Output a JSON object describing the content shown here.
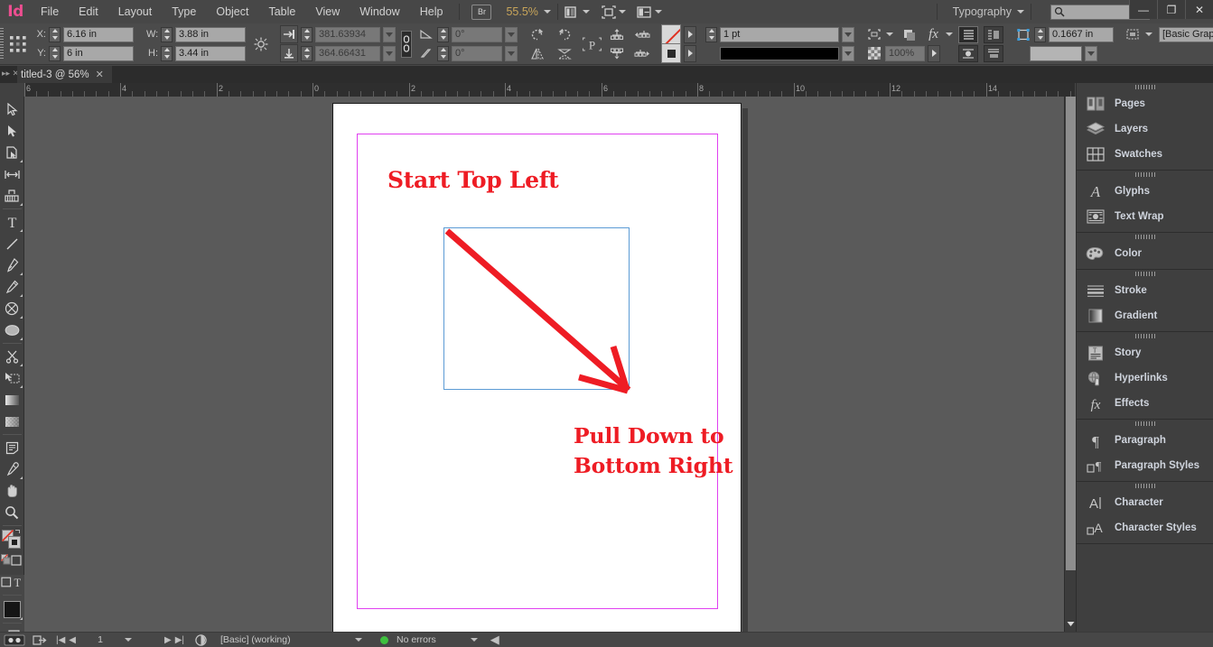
{
  "app": {
    "logo": "Id",
    "window_buttons": {
      "minimize": "—",
      "restore": "❐",
      "close": "✕"
    }
  },
  "menubar": {
    "items": [
      "File",
      "Edit",
      "Layout",
      "Type",
      "Object",
      "Table",
      "View",
      "Window",
      "Help"
    ],
    "bridge_label": "Br",
    "zoom_level": "55.5%",
    "view_mode_icon": "screen-mode-icon",
    "preview_icon": "preview-mode-icon",
    "layout_icon": "arrange-documents-icon",
    "workspace": "Typography",
    "search_placeholder": "",
    "search_icon": "search-icon"
  },
  "controlbar": {
    "reference_point_icon": "reference-point-proxy-icon",
    "x_label": "X:",
    "x_value": "6.16 in",
    "y_label": "Y:",
    "y_value": "6 in",
    "w_label": "W:",
    "w_value": "3.88 in",
    "h_label": "H:",
    "h_value": "3.44 in",
    "constrain_icon": "constrain-proportions-icon",
    "scale_x_icon": "scale-x-icon",
    "scale_x_value": "381.63934",
    "scale_y_icon": "scale-y-icon",
    "scale_y_value": "364.66431",
    "chain_icon": "link-chain-icon",
    "rotate_icon": "rotation-angle-icon",
    "rotate_value": "0°",
    "shear_icon": "shear-angle-icon",
    "shear_value": "0°",
    "rotate_ccw_icon": "rotate-counterclockwise-icon",
    "rotate_cw_icon": "rotate-clockwise-icon",
    "flip_h_icon": "flip-horizontal-icon",
    "flip_v_icon": "flip-vertical-icon",
    "container_icon": "select-container-icon",
    "align_up_icon": "bring-forward-icon",
    "align_prev_icon": "select-previous-icon",
    "align_down_icon": "send-backward-icon",
    "align_next_icon": "select-next-icon",
    "fill_swatch": "none-fill-swatch",
    "stroke_swatch": "black-stroke-swatch",
    "stroke_weight": "1 pt",
    "stroke_style_label": "solid-stroke-style",
    "effects_label": "fx",
    "opacity_value": "100%",
    "text_wrap_icon": "text-wrap-icon",
    "corner_value": "0.1667 in",
    "object_style": "[Basic Graphics Frame]",
    "bolt_icon": "quick-apply-icon"
  },
  "doctab": {
    "title": "titled-3 @ 56%",
    "close_icon": "close-tab-icon"
  },
  "ruler": {
    "units": "in",
    "labels": [
      "6",
      "4",
      "2",
      "0",
      "2",
      "4",
      "6",
      "8",
      "10",
      "12",
      "14"
    ]
  },
  "toolbox": {
    "tools": [
      {
        "name": "selection-tool",
        "glyph": "selection"
      },
      {
        "name": "direct-selection-tool",
        "glyph": "direct-selection"
      },
      {
        "name": "page-tool",
        "glyph": "page"
      },
      {
        "name": "gap-tool",
        "glyph": "gap"
      },
      {
        "name": "content-collector-tool",
        "glyph": "collector"
      },
      {
        "name": "type-tool",
        "glyph": "type"
      },
      {
        "name": "line-tool",
        "glyph": "line"
      },
      {
        "name": "pen-tool",
        "glyph": "pen"
      },
      {
        "name": "pencil-tool",
        "glyph": "pencil"
      },
      {
        "name": "frame-tool",
        "glyph": "frame-ellipse"
      },
      {
        "name": "ellipse-tool",
        "glyph": "ellipse"
      },
      {
        "name": "scissors-tool",
        "glyph": "scissors"
      },
      {
        "name": "free-transform-tool",
        "glyph": "transform"
      },
      {
        "name": "gradient-swatch-tool",
        "glyph": "gradient"
      },
      {
        "name": "gradient-feather-tool",
        "glyph": "feather"
      },
      {
        "name": "note-tool",
        "glyph": "note"
      },
      {
        "name": "eyedropper-tool",
        "glyph": "eyedropper"
      },
      {
        "name": "hand-tool",
        "glyph": "hand"
      },
      {
        "name": "zoom-tool",
        "glyph": "zoom"
      }
    ]
  },
  "document": {
    "page_label": "page-1",
    "texts": [
      {
        "name": "headline-start",
        "content": "Start Top Left"
      },
      {
        "name": "headline-pull-line1",
        "content": "Pull Down to"
      },
      {
        "name": "headline-pull-line2",
        "content": "Bottom Right"
      }
    ],
    "graphic": {
      "name": "arrow-graphic-frame",
      "description": "diagonal-arrow-pointing-down-right"
    },
    "colors": {
      "text_red": "#ee1c24",
      "margin_magenta": "#e040f0",
      "frame_blue": "#5b9bd5",
      "page_white": "#ffffff",
      "pasteboard": "#5a5a5a"
    }
  },
  "statusbar": {
    "page_number": "1",
    "preflight_profile": "[Basic] (working)",
    "error_status": "No errors",
    "status_dot_color": "#3fc03f",
    "go_to_first_icon": "first-page-icon",
    "go_to_prev_icon": "previous-page-icon",
    "go_to_next_icon": "next-page-icon",
    "go_to_last_icon": "last-page-icon",
    "preflight_icon": "preflight-icon",
    "bridge_icon": "reveal-in-bridge-icon",
    "export_icon": "export-icon"
  },
  "dock": {
    "groups": [
      {
        "name": "pages-group",
        "items": [
          {
            "label": "Pages",
            "icon": "pages-icon"
          },
          {
            "label": "Layers",
            "icon": "layers-icon"
          },
          {
            "label": "Swatches",
            "icon": "swatches-icon"
          }
        ]
      },
      {
        "name": "type-group",
        "items": [
          {
            "label": "Glyphs",
            "icon": "glyphs-icon"
          },
          {
            "label": "Text Wrap",
            "icon": "text-wrap-icon"
          }
        ]
      },
      {
        "name": "color-group",
        "items": [
          {
            "label": "Color",
            "icon": "color-palette-icon"
          }
        ]
      },
      {
        "name": "stroke-group",
        "items": [
          {
            "label": "Stroke",
            "icon": "stroke-icon"
          },
          {
            "label": "Gradient",
            "icon": "gradient-icon"
          }
        ]
      },
      {
        "name": "story-group",
        "items": [
          {
            "label": "Story",
            "icon": "story-icon"
          },
          {
            "label": "Hyperlinks",
            "icon": "hyperlinks-icon"
          },
          {
            "label": "Effects",
            "icon": "effects-icon"
          }
        ]
      },
      {
        "name": "paragraph-group",
        "items": [
          {
            "label": "Paragraph",
            "icon": "paragraph-icon"
          },
          {
            "label": "Paragraph Styles",
            "icon": "paragraph-styles-icon"
          }
        ]
      },
      {
        "name": "character-group",
        "items": [
          {
            "label": "Character",
            "icon": "character-icon"
          },
          {
            "label": "Character Styles",
            "icon": "character-styles-icon"
          }
        ]
      }
    ]
  }
}
